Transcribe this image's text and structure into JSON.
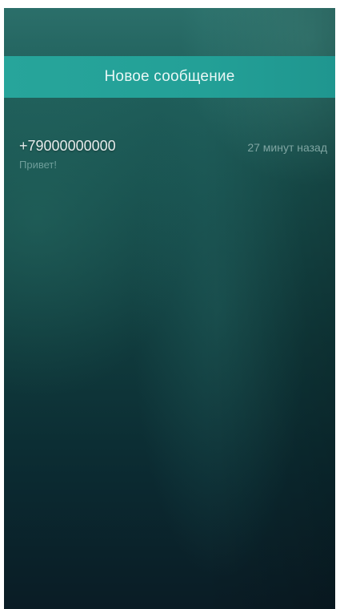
{
  "header": {
    "new_message_label": "Новое сообщение"
  },
  "messages": [
    {
      "sender": "+79000000000",
      "time": "27 минут назад",
      "preview": "Привет!"
    }
  ]
}
